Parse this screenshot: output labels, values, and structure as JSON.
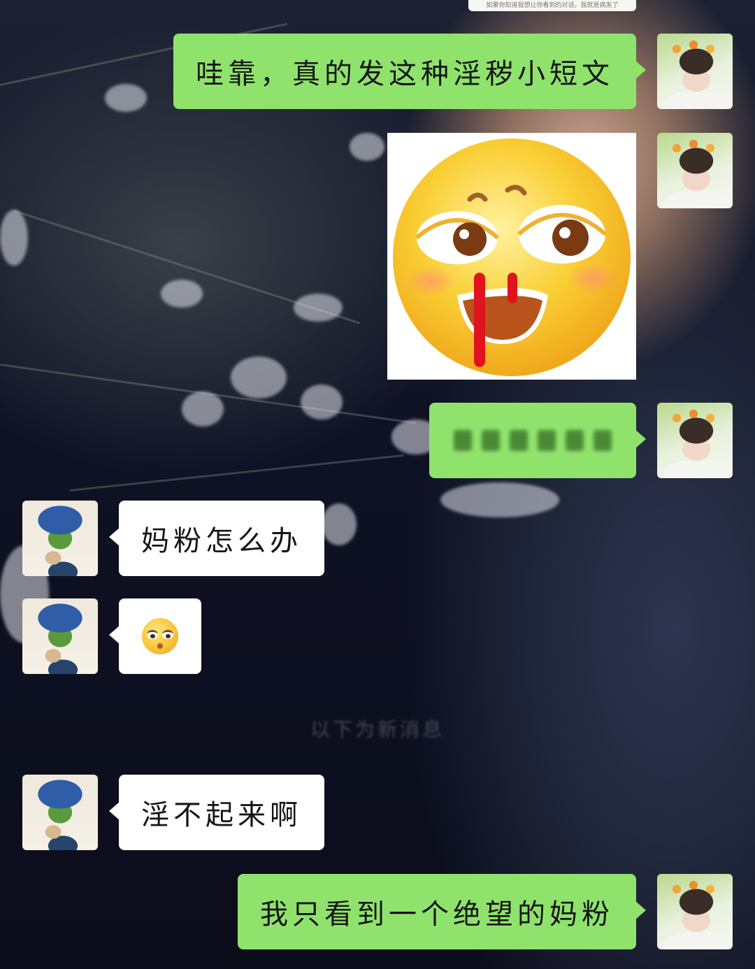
{
  "top_banner": {
    "text": "如果你知道我想让你看到的对话，我就是病发了"
  },
  "messages": [
    {
      "side": "right",
      "type": "text",
      "text": "哇靠，真的发这种淫秽小短文",
      "avatar": "boy-flower-crown-avatar"
    },
    {
      "side": "right",
      "type": "sticker",
      "sticker": "nosebleed-emoji-sticker",
      "avatar": "boy-flower-crown-avatar"
    },
    {
      "side": "right",
      "type": "blurred",
      "text": "",
      "avatar": "boy-flower-crown-avatar"
    },
    {
      "side": "left",
      "type": "text",
      "text": "妈粉怎么办",
      "avatar": "frog-avatar"
    },
    {
      "side": "left",
      "type": "emoji",
      "emoji": "rolling-eyes-emoji",
      "avatar": "frog-avatar"
    },
    {
      "side": "center",
      "type": "system",
      "text": "以下为新消息"
    },
    {
      "side": "left",
      "type": "text",
      "text": "淫不起来啊",
      "avatar": "frog-avatar"
    },
    {
      "side": "right",
      "type": "text",
      "text": "我只看到一个绝望的妈粉",
      "avatar": "boy-flower-crown-avatar"
    }
  ],
  "colors": {
    "my_bubble": "#8fe36c",
    "their_bubble": "#ffffff",
    "text": "#151515"
  }
}
